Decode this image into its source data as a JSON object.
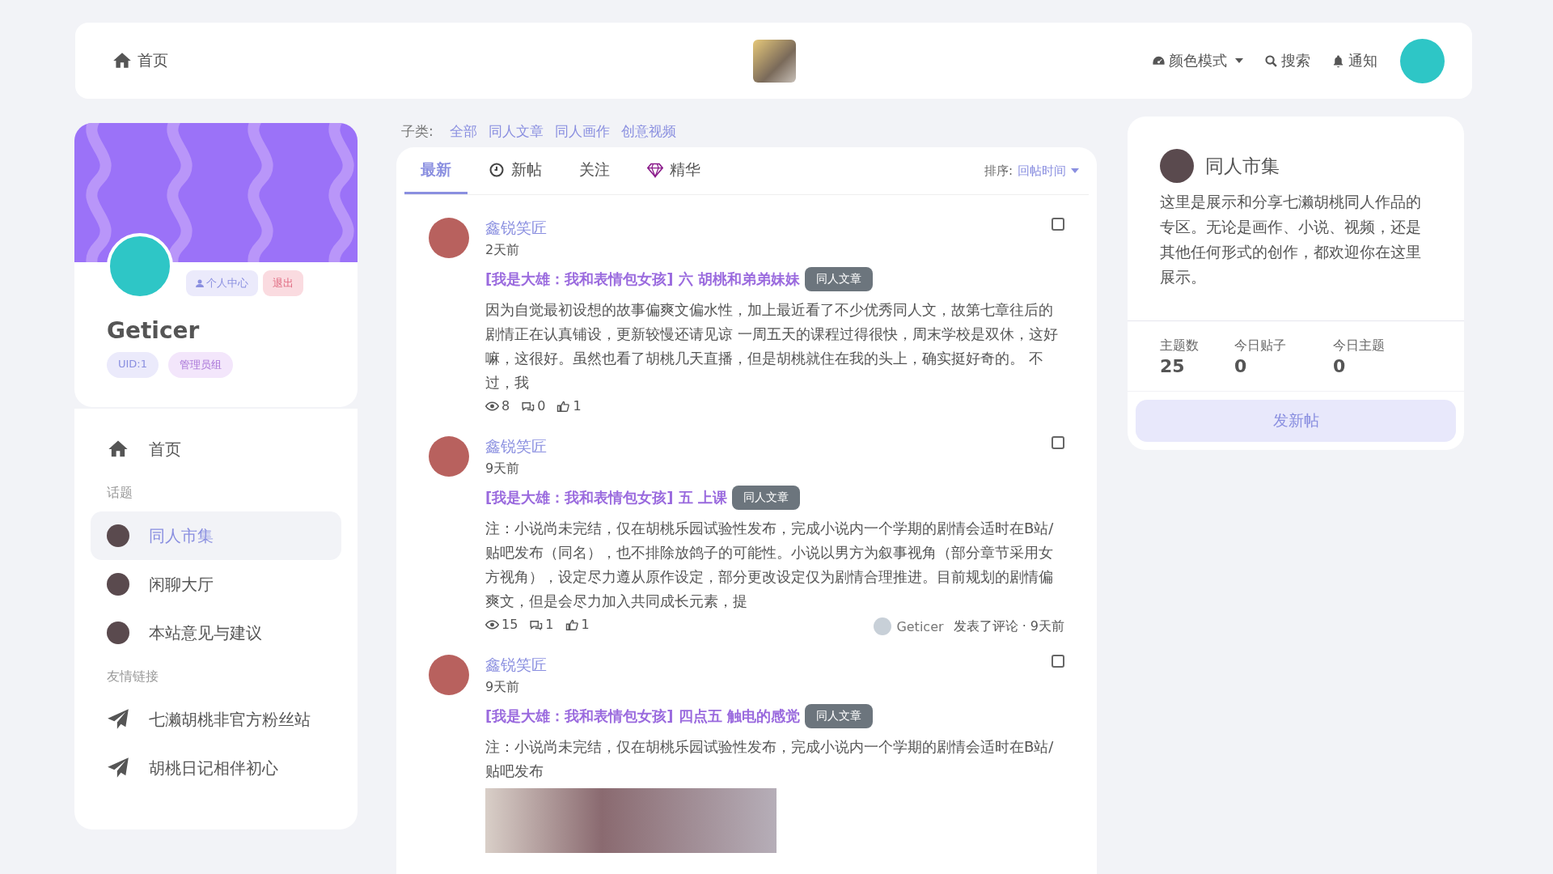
{
  "header": {
    "home": "首页",
    "actions": [
      {
        "kind": "dropdown",
        "label": "颜色模式"
      },
      {
        "kind": "link",
        "label": "搜索"
      },
      {
        "kind": "link",
        "label": "通知"
      }
    ]
  },
  "profile": {
    "name": "Geticer",
    "buttons": [
      {
        "kind": "primary",
        "label": "个人中心"
      },
      {
        "kind": "danger",
        "label": "退出"
      }
    ],
    "badges": [
      {
        "kind": "uid",
        "label": "UID:1"
      },
      {
        "kind": "group",
        "label": "管理员组"
      }
    ]
  },
  "sidebar": {
    "items": [
      {
        "kind": "home",
        "label": "首页",
        "selected": false
      },
      {
        "kind": "heading",
        "label": "话题"
      },
      {
        "kind": "topic",
        "label": "同人市集",
        "selected": true
      },
      {
        "kind": "topic",
        "label": "闲聊大厅",
        "selected": false
      },
      {
        "kind": "topic",
        "label": "本站意见与建议",
        "selected": false
      },
      {
        "kind": "heading",
        "label": "友情链接"
      },
      {
        "kind": "friend",
        "label": "七濑胡桃非官方粉丝站",
        "selected": false
      },
      {
        "kind": "friend",
        "label": "胡桃日记相伴初心",
        "selected": false
      }
    ]
  },
  "categories": {
    "label": "子类:",
    "items": [
      "全部",
      "同人文章",
      "同人画作",
      "创意视频"
    ]
  },
  "tabs": [
    {
      "label": "最新",
      "selected": true
    },
    {
      "label": "新帖",
      "selected": false
    },
    {
      "label": "关注",
      "selected": false
    },
    {
      "label": "精华",
      "selected": false
    }
  ],
  "sort": {
    "label": "排序:",
    "value": "回帖时间"
  },
  "posts": [
    {
      "author": "鑫锐笑匠",
      "time": "2天前",
      "title": "[我是大雄：我和表情包女孩] 六 胡桃和弟弟妹妹",
      "tag": "同人文章",
      "excerpt": "因为自觉最初设想的故事偏爽文偏水性，加上最近看了不少优秀同人文，故第七章往后的剧情正在认真铺设，更新较慢还请见谅 一周五天的课程过得很快，周末学校是双休，这好嘛，这很好。虽然也看了胡桃几天直播，但是胡桃就住在我的头上，确实挺好奇的。 不过，我",
      "views": "8",
      "comments": "0",
      "likes": "1",
      "checked": false,
      "has_image": false
    },
    {
      "author": "鑫锐笑匠",
      "time": "9天前",
      "title": "[我是大雄：我和表情包女孩] 五 上课",
      "tag": "同人文章",
      "excerpt": "注：小说尚未完结，仅在胡桃乐园试验性发布，完成小说内一个学期的剧情会适时在B站/贴吧发布（同名），也不排除放鸽子的可能性。小说以男方为叙事视角（部分章节采用女方视角），设定尽力遵从原作设定，部分更改设定仅为剧情合理推进。目前规划的剧情偏爽文，但是会尽力加入共同成长元素，提",
      "views": "15",
      "comments": "1",
      "likes": "1",
      "checked": false,
      "has_image": false,
      "last_reply": {
        "user": "Geticer",
        "action": "发表了评论 · 9天前"
      }
    },
    {
      "author": "鑫锐笑匠",
      "time": "9天前",
      "title": "[我是大雄：我和表情包女孩] 四点五 触电的感觉",
      "tag": "同人文章",
      "excerpt": "注：小说尚未完结，仅在胡桃乐园试验性发布，完成小说内一个学期的剧情会适时在B站/贴吧发布",
      "checked": false,
      "has_image": true
    }
  ],
  "topic": {
    "name": "同人市集",
    "description": "这里是展示和分享七濑胡桃同人作品的专区。无论是画作、小说、视频，还是其他任何形式的创作，都欢迎你在这里展示。",
    "stats": [
      {
        "label": "主题数",
        "value": "25"
      },
      {
        "label": "今日贴子",
        "value": "0"
      },
      {
        "label": "今日主题",
        "value": "0"
      }
    ],
    "button": "发新帖"
  }
}
